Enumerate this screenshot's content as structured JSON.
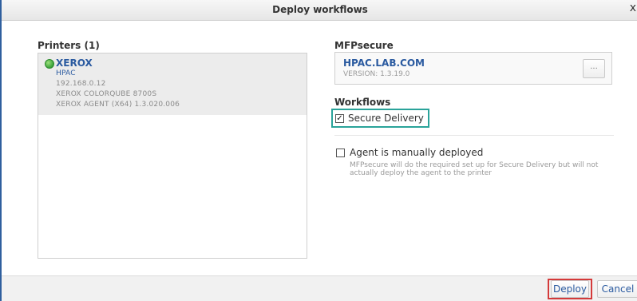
{
  "dialog": {
    "title": "Deploy workflows",
    "close_glyph": "x"
  },
  "printers": {
    "heading": "Printers (1)",
    "items": [
      {
        "name": "XEROX",
        "status_color": "#3aa13a",
        "location": "HPAC",
        "ip": "192.168.0.12",
        "model": "XEROX COLORQUBE 8700S",
        "agent": "XEROX AGENT (X64) 1.3.020.006"
      }
    ]
  },
  "mfpsecure": {
    "heading": "MFPsecure",
    "host": "HPAC.LAB.COM",
    "version": "VERSION: 1.3.19.0",
    "more_label": "..."
  },
  "workflows": {
    "heading": "Workflows",
    "secure_delivery": {
      "label": "Secure Delivery",
      "checked": true,
      "check_glyph": "✓"
    },
    "agent_manual": {
      "label": "Agent is manually deployed",
      "checked": false,
      "hint_line1": "MFPsecure will do the required set up for Secure Delivery but will not",
      "hint_line2": "actually deploy the agent to the printer"
    }
  },
  "footer": {
    "deploy_label": "Deploy",
    "cancel_label": "Cancel"
  },
  "colors": {
    "accent_blue": "#2a5aa0",
    "highlight_teal": "#2aa39a",
    "highlight_red": "#d43a3a"
  }
}
